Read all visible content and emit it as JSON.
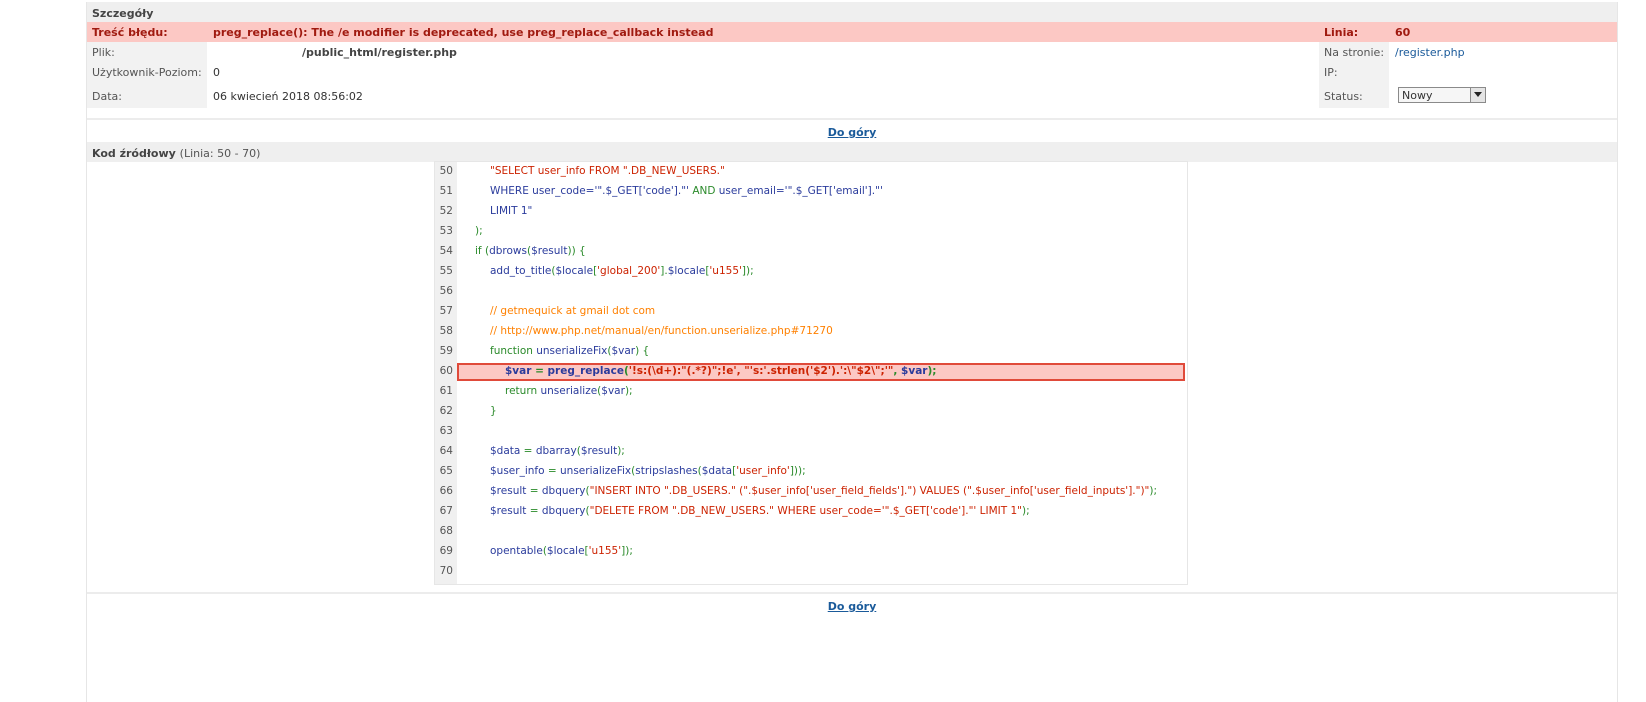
{
  "details": {
    "header": "Szczegóły",
    "error_label": "Treść błędu:",
    "error_text": "preg_replace(): The /e modifier is deprecated, use preg_replace_callback instead",
    "line_label": "Linia:",
    "line_value": "60",
    "file_label": "Plik:",
    "file_value": "/public_html/register.php",
    "page_label": "Na stronie:",
    "page_value": "/register.php",
    "user_label": "Użytkownik-Poziom:",
    "user_value": "0",
    "ip_label": "IP:",
    "ip_value": "",
    "date_label": "Data:",
    "date_value": "06 kwiecień 2018 08:56:02",
    "status_label": "Status:",
    "status_value": "Nowy"
  },
  "nav": {
    "up_label": "Do góry"
  },
  "source": {
    "header": "Kod źródłowy",
    "range": "(Linia: 50 - 70)",
    "lines": [
      {
        "n": "50",
        "indent": 2,
        "segs": [
          [
            "str",
            "\"SELECT user_info FROM \".DB_NEW_USERS.\""
          ]
        ]
      },
      {
        "n": "51",
        "indent": 2,
        "segs": [
          [
            "def",
            "WHERE user_code='\".$_GET['code'].\"' "
          ],
          [
            "kw",
            "AND"
          ],
          [
            "def",
            " user_email='\".$_GET['email'].\"'"
          ]
        ]
      },
      {
        "n": "52",
        "indent": 2,
        "segs": [
          [
            "def",
            "LIMIT 1\""
          ]
        ]
      },
      {
        "n": "53",
        "indent": 1,
        "segs": [
          [
            "kw",
            ");"
          ]
        ]
      },
      {
        "n": "54",
        "indent": 1,
        "segs": [
          [
            "kw",
            "if ("
          ],
          [
            "def",
            "dbrows"
          ],
          [
            "kw",
            "("
          ],
          [
            "def",
            "$result"
          ],
          [
            "kw",
            ")) {"
          ]
        ]
      },
      {
        "n": "55",
        "indent": 2,
        "segs": [
          [
            "def",
            "add_to_title"
          ],
          [
            "kw",
            "("
          ],
          [
            "def",
            "$locale"
          ],
          [
            "kw",
            "["
          ],
          [
            "str",
            "'global_200'"
          ],
          [
            "kw",
            "]."
          ],
          [
            "def",
            "$locale"
          ],
          [
            "kw",
            "["
          ],
          [
            "str",
            "'u155'"
          ],
          [
            "kw",
            "]);"
          ]
        ]
      },
      {
        "n": "56",
        "indent": 0,
        "segs": []
      },
      {
        "n": "57",
        "indent": 2,
        "segs": [
          [
            "com",
            "// getmequick at gmail dot com"
          ]
        ]
      },
      {
        "n": "58",
        "indent": 2,
        "segs": [
          [
            "com",
            "// http://www.php.net/manual/en/function.unserialize.php#71270"
          ]
        ]
      },
      {
        "n": "59",
        "indent": 2,
        "segs": [
          [
            "kw",
            "function "
          ],
          [
            "def",
            "unserializeFix"
          ],
          [
            "kw",
            "("
          ],
          [
            "def",
            "$var"
          ],
          [
            "kw",
            ") {"
          ]
        ]
      },
      {
        "n": "60",
        "indent": 3,
        "bold": true,
        "segs": [
          [
            "def",
            "$var"
          ],
          [
            "kw",
            " = "
          ],
          [
            "def",
            "preg_replace"
          ],
          [
            "kw",
            "("
          ],
          [
            "str",
            "'!s:(\\d+):\"(.*?)\";!e', \"'s:'.strlen('$2').':\\\"$2\\\";'\""
          ],
          [
            "kw",
            ", "
          ],
          [
            "def",
            "$var"
          ],
          [
            "kw",
            ");"
          ]
        ]
      },
      {
        "n": "61",
        "indent": 3,
        "segs": [
          [
            "kw",
            "return "
          ],
          [
            "def",
            "unserialize"
          ],
          [
            "kw",
            "("
          ],
          [
            "def",
            "$var"
          ],
          [
            "kw",
            ");"
          ]
        ]
      },
      {
        "n": "62",
        "indent": 2,
        "segs": [
          [
            "kw",
            "}"
          ]
        ]
      },
      {
        "n": "63",
        "indent": 0,
        "segs": []
      },
      {
        "n": "64",
        "indent": 2,
        "segs": [
          [
            "def",
            "$data"
          ],
          [
            "kw",
            " = "
          ],
          [
            "def",
            "dbarray"
          ],
          [
            "kw",
            "("
          ],
          [
            "def",
            "$result"
          ],
          [
            "kw",
            ");"
          ]
        ]
      },
      {
        "n": "65",
        "indent": 2,
        "segs": [
          [
            "def",
            "$user_info"
          ],
          [
            "kw",
            " = "
          ],
          [
            "def",
            "unserializeFix"
          ],
          [
            "kw",
            "("
          ],
          [
            "def",
            "stripslashes"
          ],
          [
            "kw",
            "("
          ],
          [
            "def",
            "$data"
          ],
          [
            "kw",
            "["
          ],
          [
            "str",
            "'user_info'"
          ],
          [
            "kw",
            "]));"
          ]
        ]
      },
      {
        "n": "66",
        "indent": 2,
        "segs": [
          [
            "def",
            "$result"
          ],
          [
            "kw",
            " = "
          ],
          [
            "def",
            "dbquery"
          ],
          [
            "kw",
            "("
          ],
          [
            "str",
            "\"INSERT INTO \".DB_USERS.\" (\".$user_info['user_field_fields'].\") VALUES (\".$user_info['user_field_inputs'].\")\""
          ],
          [
            "kw",
            ");"
          ]
        ]
      },
      {
        "n": "67",
        "indent": 2,
        "segs": [
          [
            "def",
            "$result"
          ],
          [
            "kw",
            " = "
          ],
          [
            "def",
            "dbquery"
          ],
          [
            "kw",
            "("
          ],
          [
            "str",
            "\"DELETE FROM \".DB_NEW_USERS.\" WHERE user_code='\".$_GET['code'].\"' LIMIT 1\""
          ],
          [
            "kw",
            ");"
          ]
        ]
      },
      {
        "n": "68",
        "indent": 0,
        "segs": []
      },
      {
        "n": "69",
        "indent": 2,
        "segs": [
          [
            "def",
            "opentable"
          ],
          [
            "kw",
            "("
          ],
          [
            "def",
            "$locale"
          ],
          [
            "kw",
            "["
          ],
          [
            "str",
            "'u155'"
          ],
          [
            "kw",
            "]);"
          ]
        ]
      },
      {
        "n": "70",
        "indent": 0,
        "segs": []
      }
    ]
  },
  "colors": {
    "error_bg": "#fcc8c4",
    "error_text": "#a01a10",
    "link": "#1a5a9a",
    "highlight_border": "#e04a3a"
  },
  "icons": {
    "select_arrow": "triangle-down-icon"
  }
}
